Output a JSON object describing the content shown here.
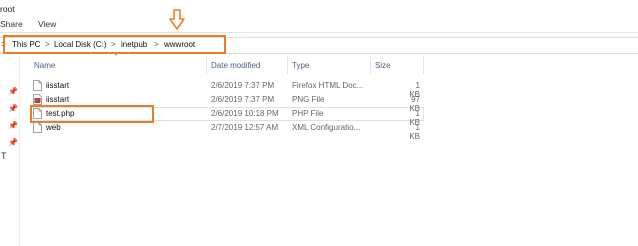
{
  "window": {
    "title_fragment": "root"
  },
  "ribbon": {
    "tabs": [
      "Share",
      "View"
    ]
  },
  "address_bar": {
    "lead_chevron": ">",
    "crumbs": [
      "This PC",
      "Local Disk (C:)",
      "inetpub",
      "wwwroot"
    ],
    "separator": ">"
  },
  "columns": {
    "name": "Name",
    "date": "Date modified",
    "type": "Type",
    "size": "Size"
  },
  "files": [
    {
      "name": "iisstart",
      "date": "2/6/2019 7:37 PM",
      "type": "Firefox HTML Doc...",
      "size": "1 KB",
      "icon": "html-file-icon"
    },
    {
      "name": "iisstart",
      "date": "2/6/2019 7:37 PM",
      "type": "PNG File",
      "size": "97 KB",
      "icon": "png-file-icon"
    },
    {
      "name": "test.php",
      "date": "2/6/2019 10:18 PM",
      "type": "PHP File",
      "size": "1 KB",
      "icon": "php-file-icon"
    },
    {
      "name": "web",
      "date": "2/7/2019 12:57 AM",
      "type": "XML Configuratio...",
      "size": "1 KB",
      "icon": "xml-file-icon"
    }
  ],
  "nav_pane": {
    "pins": [
      "pin-icon",
      "pin-icon",
      "pin-icon",
      "pin-icon"
    ],
    "partial_label": "T"
  },
  "colors": {
    "highlight": "#ee7d22",
    "header_text": "#4d6082",
    "selection_border": "#cfe4f7"
  }
}
